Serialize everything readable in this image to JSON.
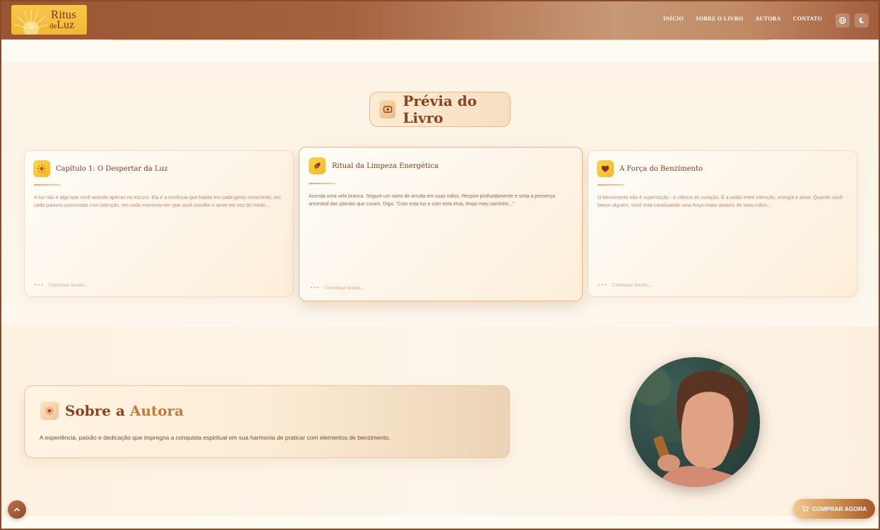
{
  "brand": {
    "name_line1": "Ritus",
    "name_line2_prefix": "de",
    "name_line2": "Luz"
  },
  "nav": {
    "items": [
      {
        "label": "INÍCIO"
      },
      {
        "label": "SOBRE O LIVRO"
      },
      {
        "label": "AUTORA"
      },
      {
        "label": "CONTATO"
      }
    ],
    "icons": [
      "globe-icon",
      "moon-icon"
    ]
  },
  "preview": {
    "title": "Prévia do Livro",
    "icon": "eye-icon",
    "cards": [
      {
        "icon": "sun-icon",
        "title": "Capítulo 1: O Despertar da Luz",
        "text": "A luz não é algo que você acende apenas no escuro. Ela é a essência que habita em cada gesto consciente, em cada palavra sussurrada com intenção, em cada momento em que você escolhe o amor em vez do medo...",
        "more": "Continue lendo..."
      },
      {
        "icon": "leaf-icon",
        "title": "Ritual da Limpeza Energética",
        "text": "Acenda uma vela branca. Segure um ramo de arruda em suas mãos. Respire profundamente e sinta a presença ancestral das plantas que curam. Diga: \"Com esta luz e com esta erva, limpo meu caminho...\"",
        "more": "Continue lendo..."
      },
      {
        "icon": "heart-icon",
        "title": "A Força do Benzimento",
        "text": "O benzimento não é superstição - é ciência do coração. É a união entre intenção, energia e amor. Quando você benze alguém, você está canalizando uma força maior através de suas mãos...",
        "more": "Continue lendo..."
      }
    ]
  },
  "author": {
    "title_part1": "Sobre a",
    "title_part2": "Autora",
    "icon": "sun-icon",
    "text": "A experiência, paixão e dedicação que impregna a conquista espiritual em sua harmonia de praticar com elementos de benzimento."
  },
  "cta": {
    "buy_label": "COMPRAR AGORA",
    "icon": "cart-icon"
  },
  "colors": {
    "accent": "#8a4320",
    "header": "#a76340",
    "gold": "#f6b729"
  }
}
